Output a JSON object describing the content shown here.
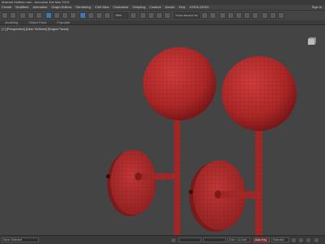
{
  "window": {
    "title": "Material Maffulo.max - Autodesk 3ds Max 2019",
    "sign_in": "Sign in"
  },
  "menu": [
    "Create",
    "Modifiers",
    "Animation",
    "Graph Editors",
    "Rendering",
    "Civil View",
    "Customize",
    "Scripting",
    "Content",
    "Arnold",
    "Help",
    "XGEN-GEN3"
  ],
  "toolbar": {
    "view_dropdown": "View",
    "selection_set": "Create Selection Set"
  },
  "ribbon": [
    "Modeling",
    "Object Paint",
    "Populate"
  ],
  "viewport": {
    "label": "[+] [Perspective] [User Defined] [Edged Faces]"
  },
  "status": {
    "selection_text": "None Selected",
    "grid_text": "Grid = 10.0cm",
    "autokey": "Auto Key",
    "set_key": "Set Key",
    "selected": "Selected"
  },
  "colors": {
    "object_red": "#b82e2e",
    "wire": "#5a1010",
    "viewport_bg": "#444444"
  }
}
